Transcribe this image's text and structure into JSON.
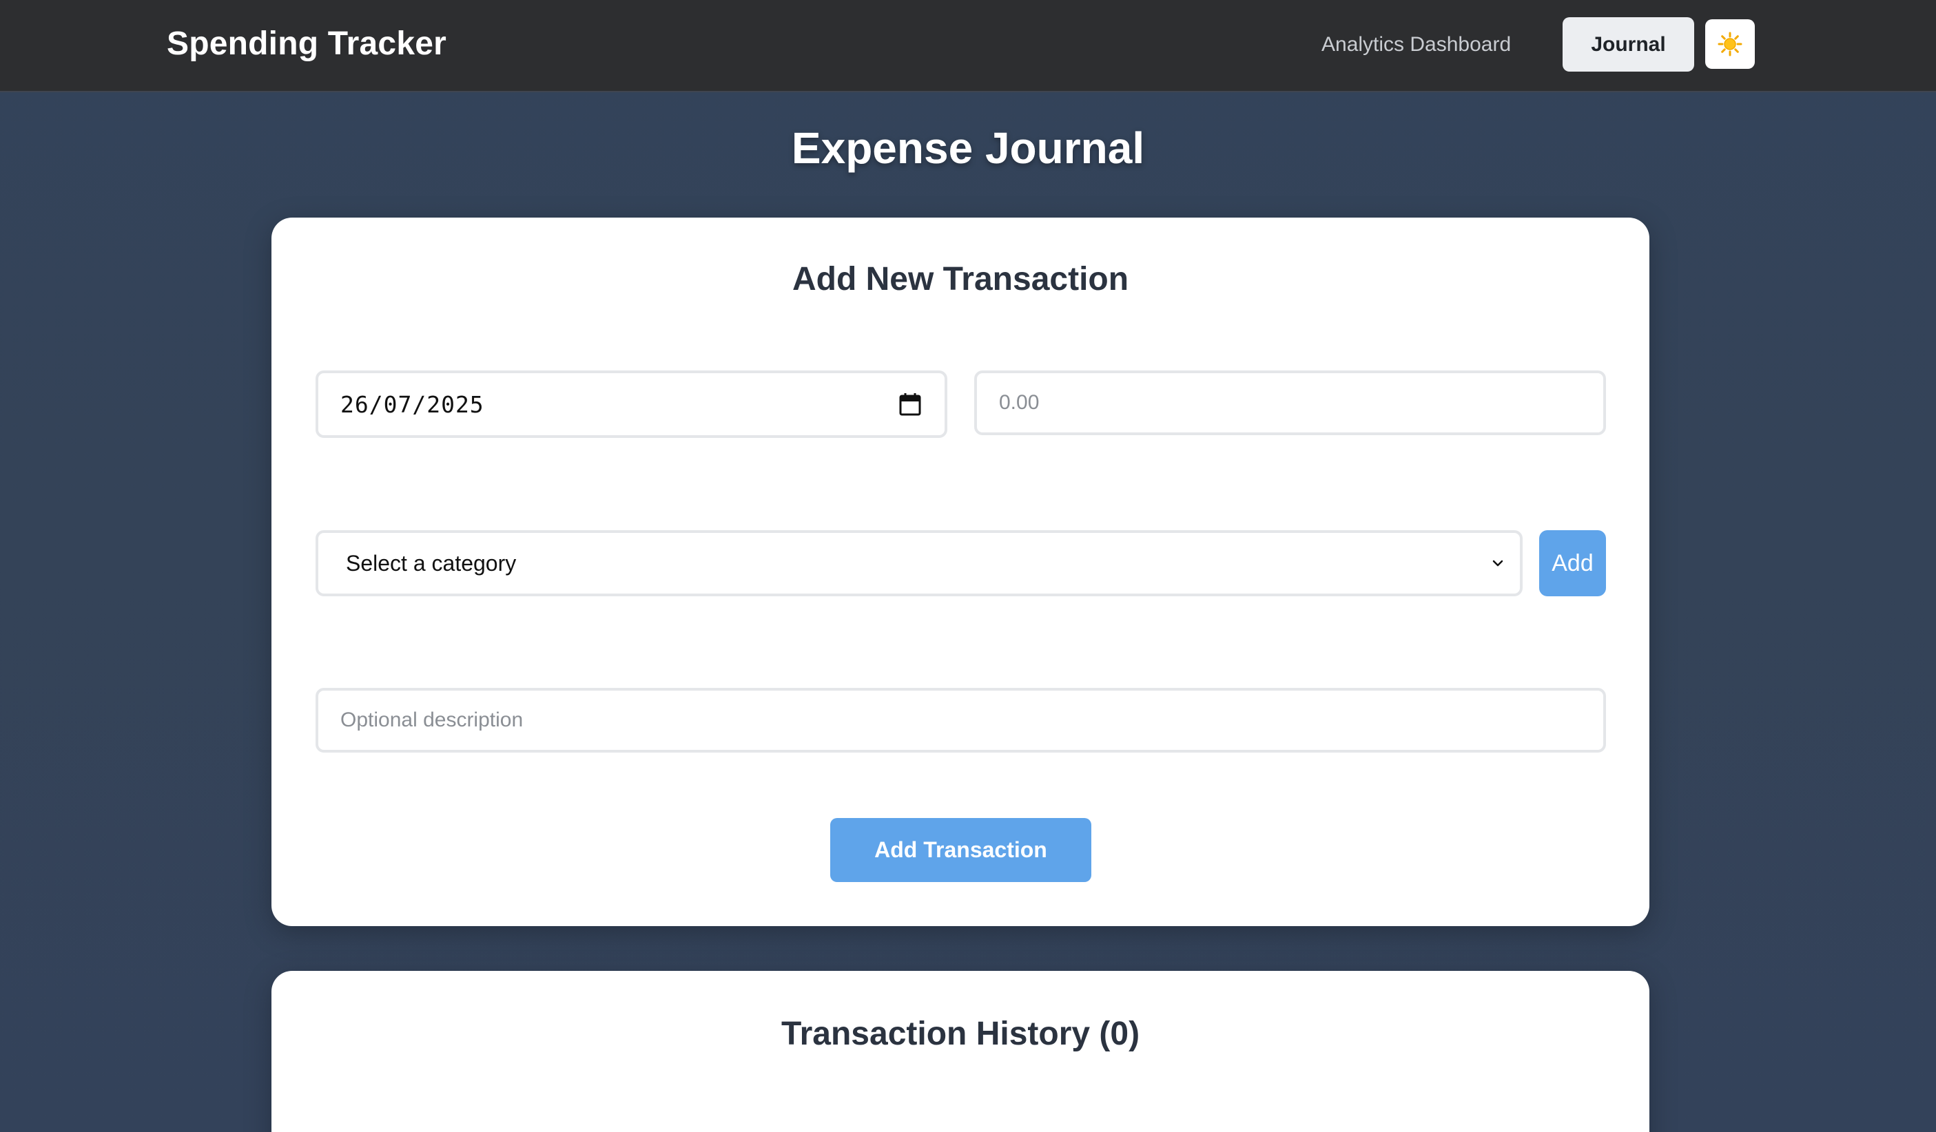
{
  "header": {
    "brand": "Spending Tracker",
    "nav": {
      "analytics_label": "Analytics Dashboard",
      "journal_label": "Journal",
      "theme_toggle_icon": "sun-icon"
    }
  },
  "main": {
    "page_title": "Expense Journal",
    "form": {
      "title": "Add New Transaction",
      "date_value": "26/07/2025",
      "amount_placeholder": "0.00",
      "category_selected": "Select a category",
      "add_category_label": "Add",
      "description_placeholder": "Optional description",
      "submit_label": "Add Transaction"
    },
    "history": {
      "title": "Transaction History (0)"
    }
  },
  "colors": {
    "topbar": "#2d2e30",
    "background": "#344358",
    "accent": "#5fa4ea",
    "card": "#ffffff"
  }
}
